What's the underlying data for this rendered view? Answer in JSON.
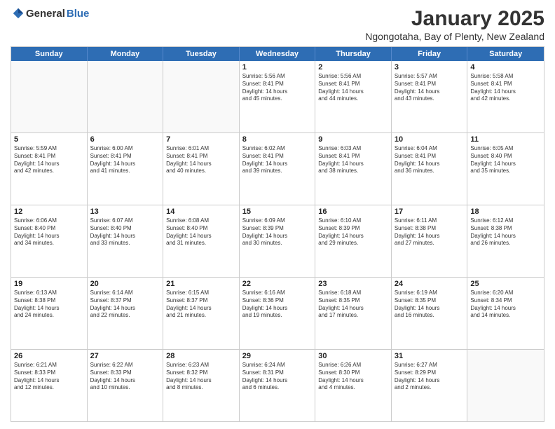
{
  "logo": {
    "general": "General",
    "blue": "Blue"
  },
  "title": {
    "month": "January 2025",
    "location": "Ngongotaha, Bay of Plenty, New Zealand"
  },
  "header_days": [
    "Sunday",
    "Monday",
    "Tuesday",
    "Wednesday",
    "Thursday",
    "Friday",
    "Saturday"
  ],
  "weeks": [
    [
      {
        "day": "",
        "info": "",
        "empty": true
      },
      {
        "day": "",
        "info": "",
        "empty": true
      },
      {
        "day": "",
        "info": "",
        "empty": true
      },
      {
        "day": "1",
        "info": "Sunrise: 5:56 AM\nSunset: 8:41 PM\nDaylight: 14 hours\nand 45 minutes.",
        "empty": false
      },
      {
        "day": "2",
        "info": "Sunrise: 5:56 AM\nSunset: 8:41 PM\nDaylight: 14 hours\nand 44 minutes.",
        "empty": false
      },
      {
        "day": "3",
        "info": "Sunrise: 5:57 AM\nSunset: 8:41 PM\nDaylight: 14 hours\nand 43 minutes.",
        "empty": false
      },
      {
        "day": "4",
        "info": "Sunrise: 5:58 AM\nSunset: 8:41 PM\nDaylight: 14 hours\nand 42 minutes.",
        "empty": false
      }
    ],
    [
      {
        "day": "5",
        "info": "Sunrise: 5:59 AM\nSunset: 8:41 PM\nDaylight: 14 hours\nand 42 minutes.",
        "empty": false
      },
      {
        "day": "6",
        "info": "Sunrise: 6:00 AM\nSunset: 8:41 PM\nDaylight: 14 hours\nand 41 minutes.",
        "empty": false
      },
      {
        "day": "7",
        "info": "Sunrise: 6:01 AM\nSunset: 8:41 PM\nDaylight: 14 hours\nand 40 minutes.",
        "empty": false
      },
      {
        "day": "8",
        "info": "Sunrise: 6:02 AM\nSunset: 8:41 PM\nDaylight: 14 hours\nand 39 minutes.",
        "empty": false
      },
      {
        "day": "9",
        "info": "Sunrise: 6:03 AM\nSunset: 8:41 PM\nDaylight: 14 hours\nand 38 minutes.",
        "empty": false
      },
      {
        "day": "10",
        "info": "Sunrise: 6:04 AM\nSunset: 8:41 PM\nDaylight: 14 hours\nand 36 minutes.",
        "empty": false
      },
      {
        "day": "11",
        "info": "Sunrise: 6:05 AM\nSunset: 8:40 PM\nDaylight: 14 hours\nand 35 minutes.",
        "empty": false
      }
    ],
    [
      {
        "day": "12",
        "info": "Sunrise: 6:06 AM\nSunset: 8:40 PM\nDaylight: 14 hours\nand 34 minutes.",
        "empty": false
      },
      {
        "day": "13",
        "info": "Sunrise: 6:07 AM\nSunset: 8:40 PM\nDaylight: 14 hours\nand 33 minutes.",
        "empty": false
      },
      {
        "day": "14",
        "info": "Sunrise: 6:08 AM\nSunset: 8:40 PM\nDaylight: 14 hours\nand 31 minutes.",
        "empty": false
      },
      {
        "day": "15",
        "info": "Sunrise: 6:09 AM\nSunset: 8:39 PM\nDaylight: 14 hours\nand 30 minutes.",
        "empty": false
      },
      {
        "day": "16",
        "info": "Sunrise: 6:10 AM\nSunset: 8:39 PM\nDaylight: 14 hours\nand 29 minutes.",
        "empty": false
      },
      {
        "day": "17",
        "info": "Sunrise: 6:11 AM\nSunset: 8:38 PM\nDaylight: 14 hours\nand 27 minutes.",
        "empty": false
      },
      {
        "day": "18",
        "info": "Sunrise: 6:12 AM\nSunset: 8:38 PM\nDaylight: 14 hours\nand 26 minutes.",
        "empty": false
      }
    ],
    [
      {
        "day": "19",
        "info": "Sunrise: 6:13 AM\nSunset: 8:38 PM\nDaylight: 14 hours\nand 24 minutes.",
        "empty": false
      },
      {
        "day": "20",
        "info": "Sunrise: 6:14 AM\nSunset: 8:37 PM\nDaylight: 14 hours\nand 22 minutes.",
        "empty": false
      },
      {
        "day": "21",
        "info": "Sunrise: 6:15 AM\nSunset: 8:37 PM\nDaylight: 14 hours\nand 21 minutes.",
        "empty": false
      },
      {
        "day": "22",
        "info": "Sunrise: 6:16 AM\nSunset: 8:36 PM\nDaylight: 14 hours\nand 19 minutes.",
        "empty": false
      },
      {
        "day": "23",
        "info": "Sunrise: 6:18 AM\nSunset: 8:35 PM\nDaylight: 14 hours\nand 17 minutes.",
        "empty": false
      },
      {
        "day": "24",
        "info": "Sunrise: 6:19 AM\nSunset: 8:35 PM\nDaylight: 14 hours\nand 16 minutes.",
        "empty": false
      },
      {
        "day": "25",
        "info": "Sunrise: 6:20 AM\nSunset: 8:34 PM\nDaylight: 14 hours\nand 14 minutes.",
        "empty": false
      }
    ],
    [
      {
        "day": "26",
        "info": "Sunrise: 6:21 AM\nSunset: 8:33 PM\nDaylight: 14 hours\nand 12 minutes.",
        "empty": false
      },
      {
        "day": "27",
        "info": "Sunrise: 6:22 AM\nSunset: 8:33 PM\nDaylight: 14 hours\nand 10 minutes.",
        "empty": false
      },
      {
        "day": "28",
        "info": "Sunrise: 6:23 AM\nSunset: 8:32 PM\nDaylight: 14 hours\nand 8 minutes.",
        "empty": false
      },
      {
        "day": "29",
        "info": "Sunrise: 6:24 AM\nSunset: 8:31 PM\nDaylight: 14 hours\nand 6 minutes.",
        "empty": false
      },
      {
        "day": "30",
        "info": "Sunrise: 6:26 AM\nSunset: 8:30 PM\nDaylight: 14 hours\nand 4 minutes.",
        "empty": false
      },
      {
        "day": "31",
        "info": "Sunrise: 6:27 AM\nSunset: 8:29 PM\nDaylight: 14 hours\nand 2 minutes.",
        "empty": false
      },
      {
        "day": "",
        "info": "",
        "empty": true
      }
    ]
  ]
}
